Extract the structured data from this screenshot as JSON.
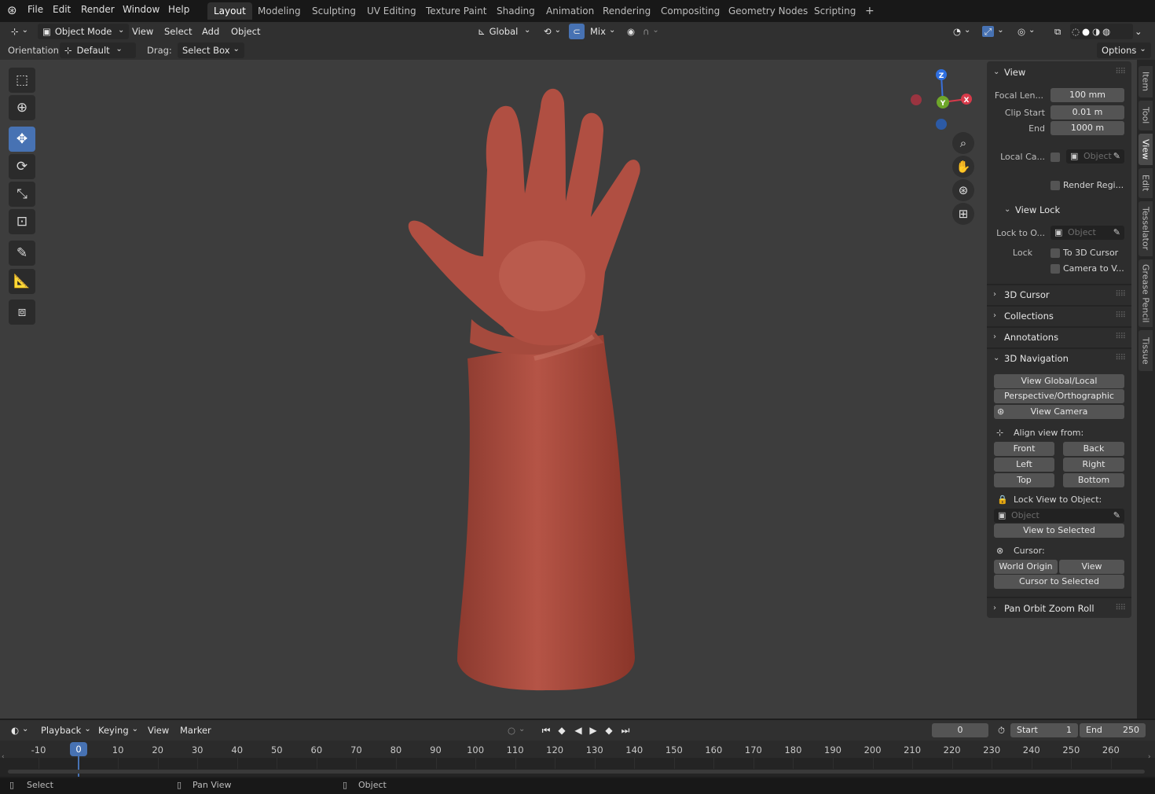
{
  "menus": [
    "File",
    "Edit",
    "Render",
    "Window",
    "Help"
  ],
  "workspaces": [
    "Layout",
    "Modeling",
    "Sculpting",
    "UV Editing",
    "Texture Paint",
    "Shading",
    "Animation",
    "Rendering",
    "Compositing",
    "Geometry Nodes",
    "Scripting"
  ],
  "active_workspace": "Layout",
  "header": {
    "mode": "Object Mode",
    "menus": [
      "View",
      "Select",
      "Add",
      "Object"
    ],
    "transform_orientation": "Global",
    "snap_target": "Mix"
  },
  "tool_options": {
    "orientation_label": "Orientation:",
    "orientation_value": "Default",
    "drag_label": "Drag:",
    "drag_value": "Select Box",
    "options_label": "Options"
  },
  "gizmo": {
    "z": "Z",
    "x": "X",
    "y": "Y"
  },
  "npanel": {
    "view_title": "View",
    "focal_label": "Focal Len...",
    "focal_value": "100 mm",
    "clip_start_label": "Clip Start",
    "clip_start_value": "0.01 m",
    "end_label": "End",
    "end_value": "1000 m",
    "local_camera_label": "Local Ca...",
    "local_camera_placeholder": "Object",
    "render_region_label": "Render Regi...",
    "view_lock_title": "View Lock",
    "lock_to_object_label": "Lock to O...",
    "lock_to_object_placeholder": "Object",
    "lock_label": "Lock",
    "to_3d_cursor": "To 3D Cursor",
    "camera_to_view": "Camera to V...",
    "collapsed_panels": [
      "3D Cursor",
      "Collections",
      "Annotations"
    ],
    "nav_title": "3D Navigation",
    "view_global_local": "View Global/Local",
    "persp_ortho": "Perspective/Orthographic",
    "view_camera": "View Camera",
    "align_label": "Align view from:",
    "align": {
      "front": "Front",
      "back": "Back",
      "left": "Left",
      "right": "Right",
      "top": "Top",
      "bottom": "Bottom"
    },
    "lock_view_label": "Lock View to Object:",
    "lock_view_placeholder": "Object",
    "view_to_selected": "View to Selected",
    "cursor_label": "Cursor:",
    "world_origin": "World Origin",
    "view_btn": "View",
    "cursor_to_selected": "Cursor to Selected",
    "pan_orbit_title": "Pan Orbit Zoom Roll"
  },
  "side_tabs": [
    "Item",
    "Tool",
    "View",
    "Edit",
    "Tesselator",
    "Grease Pencil",
    "Tissue"
  ],
  "active_side_tab": "View",
  "timeline": {
    "menus": [
      "Playback",
      "Keying",
      "View",
      "Marker"
    ],
    "current_frame": "0",
    "start_label": "Start",
    "start_value": "1",
    "end_label": "End",
    "end_value": "250",
    "ruler_ticks": [
      "-10",
      "0",
      "10",
      "20",
      "30",
      "40",
      "50",
      "60",
      "70",
      "80",
      "90",
      "100",
      "110",
      "120",
      "130",
      "140",
      "150",
      "160",
      "170",
      "180",
      "190",
      "200",
      "210",
      "220",
      "230",
      "240",
      "250",
      "260"
    ],
    "playhead_frame": "0"
  },
  "status": {
    "select": "Select",
    "pan_view": "Pan View",
    "object": "Object"
  },
  "colors": {
    "accent": "#4772b3",
    "mesh": "#a84a3c",
    "viewport_bg": "#3d3d3d"
  }
}
